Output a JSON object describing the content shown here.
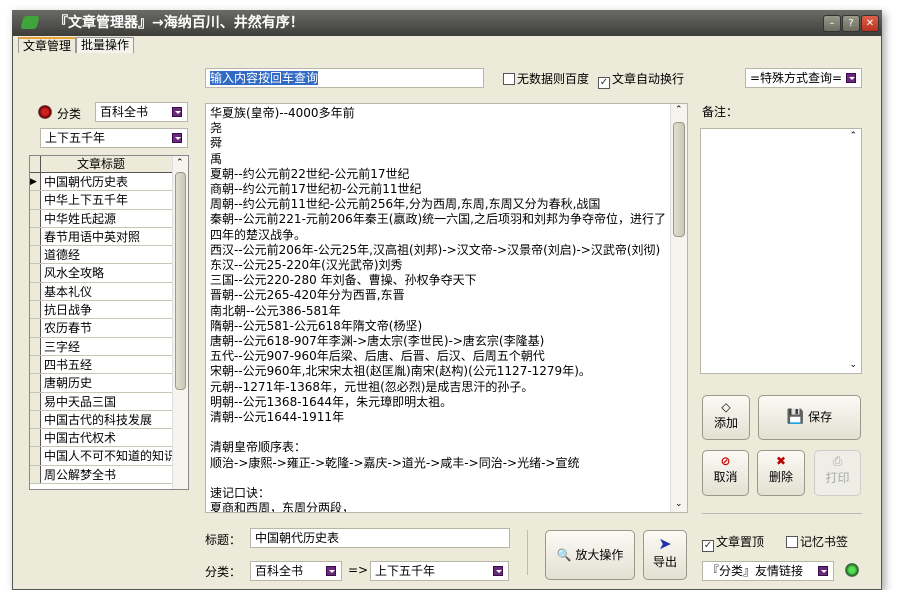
{
  "window": {
    "title": "『文章管理器』→海纳百川、井然有序！",
    "minimize": "–",
    "help": "?",
    "close": "✕"
  },
  "tabs": [
    {
      "label": "文章管理",
      "active": true
    },
    {
      "label": "批量操作",
      "active": false
    }
  ],
  "search": {
    "value": "输入内容按回车查询",
    "no_data_baidu": "无数据则百度",
    "no_data_baidu_checked": false,
    "auto_wrap": "文章自动换行",
    "auto_wrap_checked": true,
    "special_query": "=特殊方式查询="
  },
  "filter": {
    "category_label": "分类",
    "category_value": "百科全书",
    "subcategory_value": "上下五千年"
  },
  "grid": {
    "header": "文章标题",
    "selected_index": 0,
    "rows": [
      "中国朝代历史表",
      "中华上下五千年",
      "中华姓氏起源",
      "春节用语中英对照",
      "道德经",
      "风水全攻略",
      "基本礼仪",
      "抗日战争",
      "农历春节",
      "三字经",
      "四书五经",
      "唐朝历史",
      "易中天品三国",
      "中国古代的科技发展",
      "中国古代权术",
      "中国人不可不知道的知识",
      "周公解梦全书"
    ]
  },
  "content": {
    "text": "华夏族(皇帝)--4000多年前\n尧\n舜\n禹\n夏朝--约公元前22世纪-公元前17世纪\n商朝--约公元前17世纪初-公元前11世纪\n周朝--约公元前11世纪-公元前256年,分为西周,东周,东周又分为春秋,战国\n秦朝--公元前221-元前206年秦王(嬴政)统一六国,之后项羽和刘邦为争夺帝位，进行了四年的楚汉战争。\n西汉--公元前206年-公元25年,汉高祖(刘邦)->汉文帝->汉景帝(刘启)->汉武帝(刘彻)\n东汉--公元25-220年(汉光武帝)刘秀\n三国--公元220-280 年刘备、曹操、孙权争夺天下\n晋朝--公元265-420年分为西晋,东晋\n南北朝--公元386-581年\n隋朝--公元581-公元618年隋文帝(杨坚)\n唐朝--公元618-907年李渊->唐太宗(李世民)->唐玄宗(李隆基)\n五代--公元907-960年后梁、后唐、后晋、后汉、后周五个朝代\n宋朝--公元960年,北宋宋太祖(赵匡胤)南宋(赵构)(公元1127-1279年)。\n元朝--1271年-1368年，元世祖(忽必烈)是成吉思汗的孙子。\n明朝--公元1368-1644年，朱元璋即明太祖。\n清朝--公元1644-1911年\n\n清朝皇帝顺序表：\n顺治->康熙->雍正->乾隆->嘉庆->道光->咸丰->同治->光绪->宣统\n\n速记口诀：\n夏商和西周，东周分两段，\n春秋和战国，一统秦两汉，\n三分魏蜀吴，二晋前后延，\n南北朝并列，隋唐五代传，"
  },
  "notes": {
    "label": "备注："
  },
  "buttons": {
    "add": "添加",
    "save": "保存",
    "cancel": "取消",
    "delete": "删除",
    "print": "打印",
    "zoom": "放大操作",
    "export": "导出"
  },
  "options": {
    "pin": "文章置顶",
    "pin_checked": true,
    "bookmark": "记忆书签",
    "bookmark_checked": false,
    "links": "『分类』友情链接"
  },
  "edit": {
    "title_label": "标题：",
    "title_value": "中国朝代历史表",
    "category_label": "分类：",
    "category_value": "百科全书",
    "arrow": "=>",
    "subcategory_value": "上下五千年"
  }
}
